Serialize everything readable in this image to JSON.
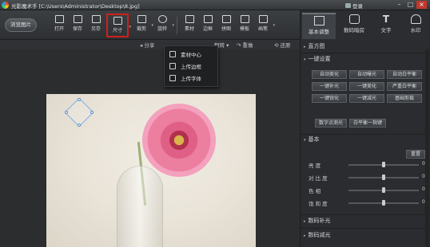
{
  "window": {
    "title": "光影魔术手 [C:\\Users\\Administrator\\Desktop\\8.jpg]",
    "login_label": "登录",
    "minimize": "–",
    "maximize": "□",
    "close": "×"
  },
  "toolbar": {
    "browse_label": "浏览图片",
    "tools": [
      {
        "label": "打开",
        "icon": "folder-open-icon"
      },
      {
        "label": "保存",
        "icon": "save-icon"
      },
      {
        "label": "另存",
        "icon": "save-as-icon"
      },
      {
        "label": "尺寸",
        "icon": "resize-icon"
      },
      {
        "label": "裁剪",
        "icon": "crop-icon"
      },
      {
        "label": "旋转",
        "icon": "rotate-icon"
      },
      {
        "label": "素材",
        "icon": "material-icon"
      },
      {
        "label": "边框",
        "icon": "border-icon"
      },
      {
        "label": "拼图",
        "icon": "collage-icon"
      },
      {
        "label": "模板",
        "icon": "template-icon"
      },
      {
        "label": "画笔",
        "icon": "brush-icon"
      }
    ]
  },
  "subbar": {
    "share": "分享",
    "right_item": "翻转",
    "redo": "重做",
    "restore": "还原"
  },
  "dropdown": {
    "items": [
      {
        "label": "素材中心",
        "icon": "material-center-icon"
      },
      {
        "label": "上传边框",
        "icon": "upload-border-icon"
      },
      {
        "label": "上传字体",
        "icon": "upload-font-icon"
      }
    ]
  },
  "right_tabs": [
    {
      "label": "基本调整",
      "icon": "adjust-icon"
    },
    {
      "label": "数码暗房",
      "icon": "camera-icon"
    },
    {
      "label": "文字",
      "icon": "text-icon"
    },
    {
      "label": "水印",
      "icon": "watermark-icon"
    }
  ],
  "panel": {
    "histogram_title": "直方图",
    "onekey_title": "一键设置",
    "onekey_buttons": [
      "自动美化",
      "自动曝光",
      "自动白平衡",
      "一键补光",
      "一键美化",
      "严重白平衡",
      "一键锐化",
      "一键减光",
      "基础剪裁"
    ],
    "digital_fill": "数字点测光",
    "white_balance": "白平衡一指键",
    "basic_title": "基本",
    "reset_label": "重置",
    "sliders": [
      {
        "label": "亮  度",
        "value": 0
      },
      {
        "label": "对 比 度",
        "value": 0
      },
      {
        "label": "色    相",
        "value": 0
      },
      {
        "label": "饱 和 度",
        "value": 0
      }
    ],
    "digital_fill_light_title": "数码补光",
    "digital_reduce_light_title": "数码减光"
  },
  "colors": {
    "highlight_red": "#d0201c",
    "panel_bg": "#2a2c2f"
  }
}
